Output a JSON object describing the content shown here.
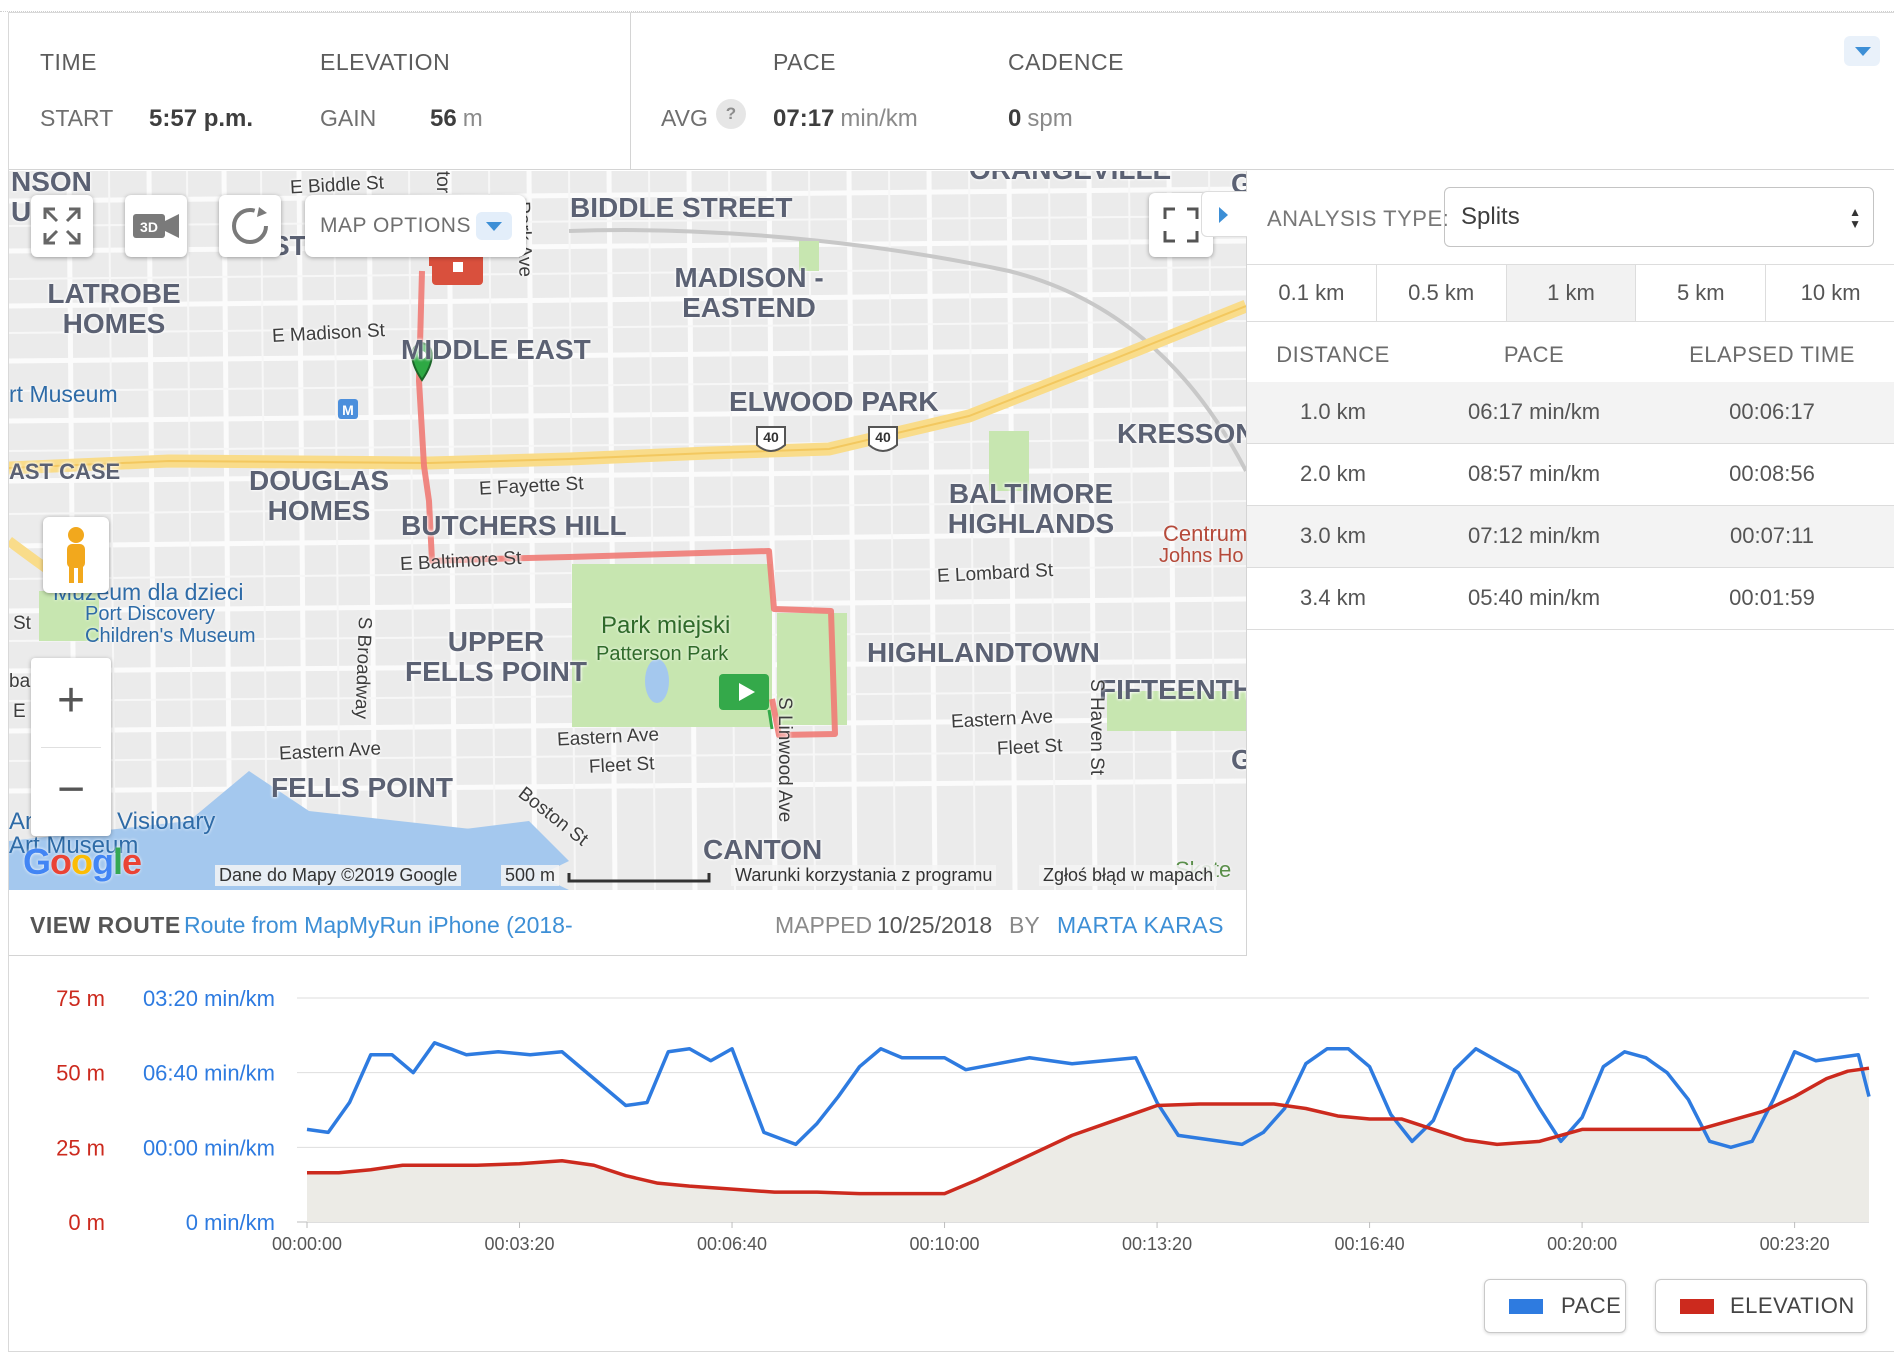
{
  "stats": {
    "time_heading": "TIME",
    "start_label": "START",
    "start_value": "5:57 p.m.",
    "elevation_heading": "ELEVATION",
    "gain_label": "GAIN",
    "gain_value": "56",
    "gain_unit": "m",
    "pace_heading": "PACE",
    "avg_label": "AVG",
    "help_glyph": "?",
    "avg_value": "07:17",
    "avg_unit": "min/km",
    "cadence_heading": "CADENCE",
    "cadence_value": "0",
    "cadence_unit": "spm"
  },
  "map": {
    "options_label": "MAP OPTIONS",
    "btn_3d": "3D",
    "neighborhoods": {
      "nson": "NSON",
      "ua": "UA",
      "st": "ST",
      "latrobe": "LATROBE HOMES",
      "biddle": "BIDDLE STREET",
      "madison": "MADISON - EASTEND",
      "middle_east": "MIDDLE EAST",
      "elwood": "ELWOOD PARK",
      "kresson": "KRESSON",
      "ast_case": "AST CASE",
      "douglas": "DOUGLAS HOMES",
      "butchers": "BUTCHERS HILL",
      "baltimore_highlands": "BALTIMORE HIGHLANDS",
      "upper_fells": "UPPER FELLS POINT",
      "highlandtown": "HIGHLANDTOWN",
      "fifteenth": "FIFTEENTH",
      "fells_point": "FELLS POINT",
      "canton": "CANTON",
      "orangeville": "ORANGEVILLE",
      "g1": "G",
      "g2": "G"
    },
    "streets": {
      "e_biddle": "E Biddle St",
      "e_madison": "E Madison St",
      "park_ave": "Park Ave",
      "e_fayette": "E Fayette St",
      "e_baltimore": "E Baltimore St",
      "e_lombard": "E Lombard St",
      "s_broadway": "S Broadway",
      "eastern_ave_1": "Eastern Ave",
      "eastern_ave_2": "Eastern Ave",
      "eastern_ave_3": "Eastern Ave",
      "fleet_1": "Fleet St",
      "fleet_2": "Fleet St",
      "s_haven": "S Haven St",
      "s_linwood": "S Linwood Ave",
      "boston": "Boston St",
      "st_left": "St",
      "e_left": "E",
      "bar_left": "bar",
      "tor": "tor"
    },
    "pois": {
      "art_museum": "rt Museum",
      "museum_children_pl": "Muzeum dla dzieci",
      "port_discovery": "Port Discovery",
      "childrens_museum": "Children's Museum",
      "park_pl": "Park miejski",
      "patterson": "Patterson Park",
      "avm_1": "American Visionary",
      "avm_2": "Art Museum",
      "centrum": "Centrum",
      "johns_hopkins": "Johns Ho",
      "skate": "Skate"
    },
    "shields": [
      "40",
      "40"
    ],
    "metro_glyph": "M",
    "attribution": "Dane do Mapy ©2019 Google",
    "scale_label": "500 m",
    "terms": "Warunki korzystania z programu",
    "report": "Zgłoś błąd w mapach",
    "google": "Google",
    "zoom_in": "+",
    "zoom_out": "−"
  },
  "route": {
    "view_label": "VIEW ROUTE",
    "route_link": "Route from MapMyRun iPhone (2018-",
    "mapped_label": "MAPPED",
    "mapped_date": "10/25/2018",
    "by_label": "BY",
    "user": "MARTA KARAS"
  },
  "analysis": {
    "type_label": "ANALYSIS TYPE:",
    "type_value": "Splits",
    "intervals": [
      "0.1 km",
      "0.5 km",
      "1 km",
      "5 km",
      "10 km"
    ],
    "active_interval": "1 km",
    "columns": [
      "DISTANCE",
      "PACE",
      "ELAPSED TIME"
    ],
    "splits": [
      {
        "distance": "1.0 km",
        "pace": "06:17 min/km",
        "elapsed": "00:06:17"
      },
      {
        "distance": "2.0 km",
        "pace": "08:57 min/km",
        "elapsed": "00:08:56"
      },
      {
        "distance": "3.0 km",
        "pace": "07:12 min/km",
        "elapsed": "00:07:11"
      },
      {
        "distance": "3.4 km",
        "pace": "05:40 min/km",
        "elapsed": "00:01:59"
      }
    ]
  },
  "legend": {
    "pace": "PACE",
    "elevation": "ELEVATION"
  },
  "colors": {
    "pace": "#2e7be0",
    "elevation": "#cc2a1e",
    "accent": "#3d8fd6",
    "route": "#ef7b76"
  },
  "chart_data": {
    "type": "line",
    "x_unit": "elapsed time (s)",
    "xlim": [
      0,
      1470
    ],
    "x_ticks": [
      0,
      200,
      400,
      600,
      800,
      1000,
      1200,
      1400
    ],
    "x_tick_labels": [
      "00:00:00",
      "00:03:20",
      "00:06:40",
      "00:10:00",
      "00:13:20",
      "00:16:40",
      "00:20:00",
      "00:23:20"
    ],
    "left_axis": {
      "unit": "m",
      "ticks": [
        0,
        25,
        50,
        75
      ],
      "tick_labels": [
        "0 m",
        "25 m",
        "50 m",
        "75 m"
      ],
      "ylim": [
        0,
        75
      ]
    },
    "right_axis_ticks": [
      "0 min/km",
      "00:00 min/km",
      "06:40 min/km",
      "03:20 min/km"
    ],
    "grid": true,
    "legend": "bottom-right",
    "series": [
      {
        "name": "ELEVATION",
        "axis": "m",
        "x": [
          0,
          30,
          60,
          90,
          120,
          160,
          200,
          240,
          270,
          300,
          330,
          360,
          400,
          440,
          480,
          520,
          560,
          600,
          630,
          660,
          690,
          720,
          760,
          800,
          840,
          880,
          910,
          940,
          970,
          1000,
          1030,
          1060,
          1090,
          1120,
          1160,
          1200,
          1240,
          1280,
          1310,
          1340,
          1370,
          1400,
          1430,
          1450,
          1470
        ],
        "y": [
          16.5,
          16.5,
          17.5,
          19,
          19,
          19,
          19.5,
          20.5,
          19,
          15.5,
          13,
          12,
          11,
          10,
          10,
          9.5,
          9.5,
          9.5,
          14,
          19,
          24,
          29,
          34,
          39,
          39.5,
          39.5,
          39.5,
          38,
          35.5,
          34.5,
          34.5,
          31,
          27.5,
          26,
          27,
          31,
          31,
          31,
          31,
          34,
          37,
          42,
          48,
          50.5,
          51.5
        ]
      },
      {
        "name": "PACE",
        "axis": "m",
        "x": [
          0,
          20,
          40,
          60,
          80,
          100,
          120,
          150,
          180,
          210,
          240,
          270,
          300,
          320,
          340,
          360,
          380,
          400,
          430,
          460,
          480,
          500,
          520,
          540,
          560,
          580,
          600,
          620,
          650,
          680,
          700,
          720,
          750,
          780,
          800,
          820,
          840,
          860,
          880,
          900,
          920,
          940,
          960,
          980,
          1000,
          1020,
          1040,
          1060,
          1080,
          1100,
          1120,
          1140,
          1160,
          1180,
          1200,
          1220,
          1240,
          1260,
          1280,
          1300,
          1320,
          1340,
          1360,
          1380,
          1400,
          1420,
          1440,
          1460,
          1470
        ],
        "y": [
          31,
          30,
          40,
          56,
          56,
          50,
          60,
          56,
          57,
          56,
          57,
          48,
          39,
          40,
          57,
          58,
          54,
          58,
          30,
          26,
          33,
          42,
          52,
          58,
          55,
          55,
          55,
          51,
          53,
          55,
          54,
          53,
          54,
          55,
          40,
          29,
          28,
          27,
          26,
          30,
          38,
          53,
          58,
          58,
          52,
          36,
          27,
          34,
          51,
          58,
          54,
          50,
          38,
          27,
          35,
          52,
          57,
          55,
          50,
          41,
          27,
          25,
          27,
          41,
          57,
          54,
          55,
          56,
          42
        ]
      }
    ]
  }
}
